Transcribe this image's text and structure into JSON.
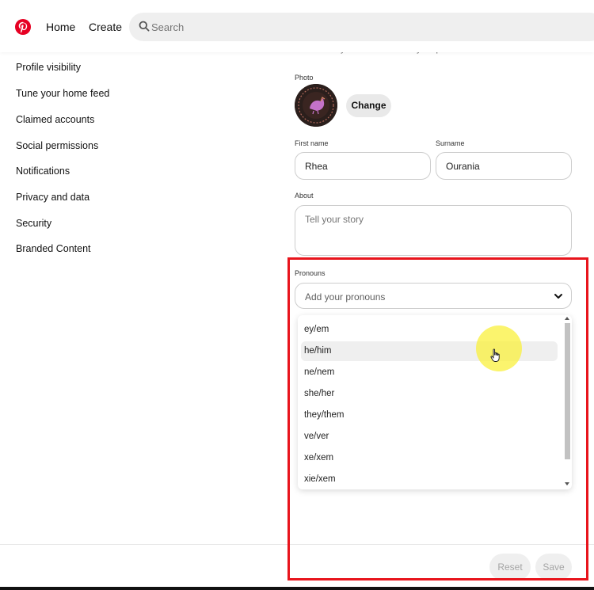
{
  "topbar": {
    "logo_icon": "pinterest-logo-icon",
    "home_label": "Home",
    "create_label": "Create",
    "search_placeholder": "Search"
  },
  "sidebar": {
    "items": [
      {
        "label": "Profile visibility"
      },
      {
        "label": "Tune your home feed"
      },
      {
        "label": "Claimed accounts"
      },
      {
        "label": "Social permissions"
      },
      {
        "label": "Notifications"
      },
      {
        "label": "Privacy and data"
      },
      {
        "label": "Security"
      },
      {
        "label": "Branded Content"
      }
    ]
  },
  "profile": {
    "intro_text": "visible to anyone who can view your profile.",
    "photo_label": "Photo",
    "change_label": "Change",
    "first_name_label": "First name",
    "first_name_value": "Rhea",
    "surname_label": "Surname",
    "surname_value": "Ourania",
    "about_label": "About",
    "about_placeholder": "Tell your story",
    "pronouns_label": "Pronouns",
    "pronouns_placeholder": "Add your pronouns"
  },
  "dropdown": {
    "options": [
      "ey/em",
      "he/him",
      "ne/nem",
      "she/her",
      "they/them",
      "ve/ver",
      "xe/xem",
      "xie/xem"
    ],
    "hovered_index": 1
  },
  "footer": {
    "reset_label": "Reset",
    "save_label": "Save"
  },
  "colors": {
    "brand": "#e60023",
    "annotation": "#e8141c",
    "cursor_highlight": "#f5ec3c"
  }
}
